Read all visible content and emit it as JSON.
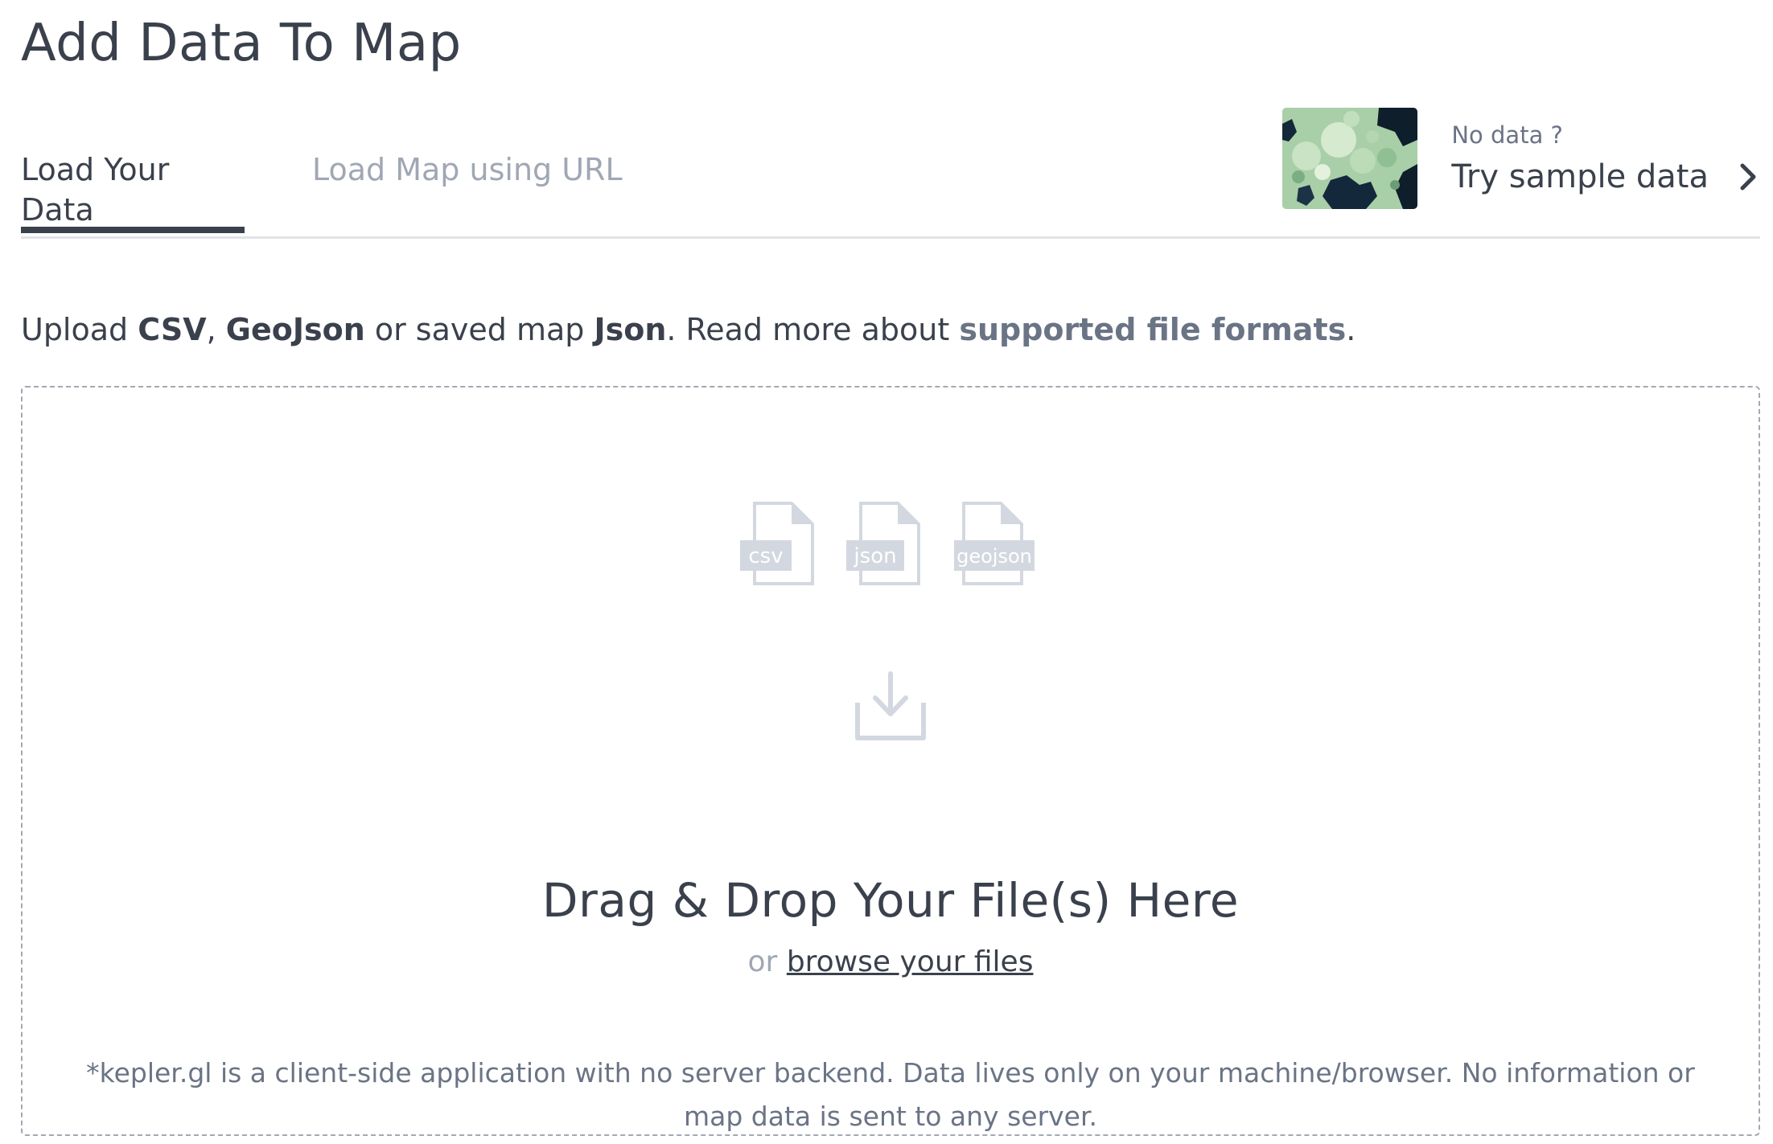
{
  "header": {
    "title": "Add Data To Map"
  },
  "tabs": [
    {
      "label": "Load Your Data",
      "active": true
    },
    {
      "label": "Load Map using URL",
      "active": false
    }
  ],
  "sample": {
    "hint": "No data ?",
    "link": "Try sample data",
    "icon": "chevron-right-icon"
  },
  "intro": {
    "upload": "Upload ",
    "csv": "CSV",
    "comma": ", ",
    "geojson": "GeoJson",
    "or_saved": " or saved map ",
    "json": "Json",
    "read_more": ". Read more about ",
    "formats_link": "supported file formats",
    "period": "."
  },
  "dropzone": {
    "file_types": [
      "csv",
      "json",
      "geojson"
    ],
    "title": "Drag & Drop Your File(s) Here",
    "or": "or ",
    "browse": "browse your files",
    "disclaimer": "*kepler.gl is a client-side application with no server backend. Data lives only on your machine/browser. No information or map data is sent to any server."
  },
  "colors": {
    "text_primary": "#3a414c",
    "text_muted": "#a0a7b4",
    "text_secondary": "#6a7485",
    "icon_gray": "#d3d8e0",
    "border": "#e1e3e6"
  }
}
